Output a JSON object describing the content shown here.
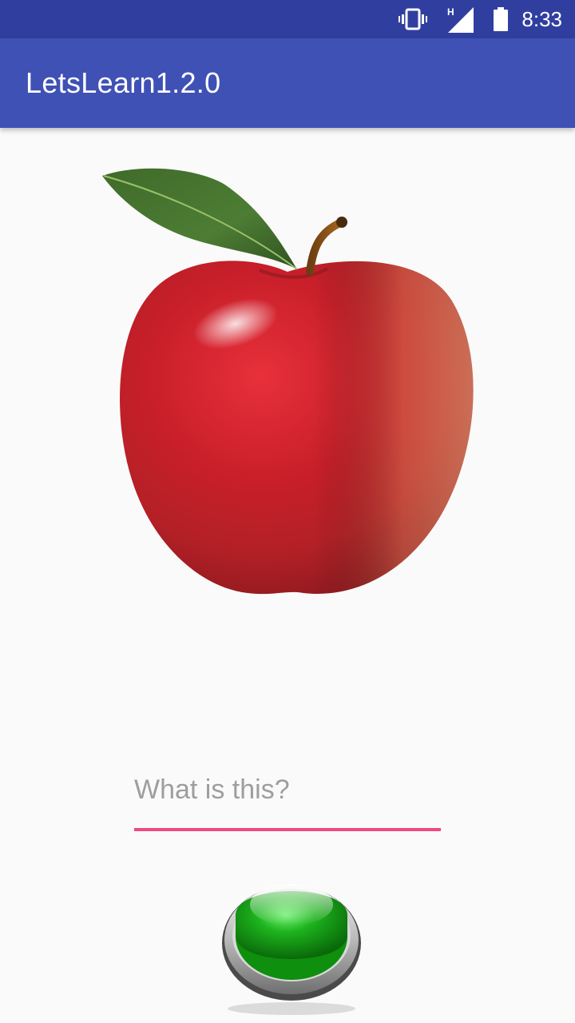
{
  "status_bar": {
    "time": "8:33",
    "network": "H",
    "icons": [
      "vibrate-icon",
      "signal-icon",
      "battery-icon"
    ]
  },
  "app_bar": {
    "title": "LetsLearn1.2.0"
  },
  "quiz": {
    "image_subject": "apple",
    "answer": {
      "value": "",
      "placeholder": "What is this?"
    },
    "submit_icon": "green-push-button-icon"
  },
  "colors": {
    "status_bar": "#303f9f",
    "app_bar": "#3f51b5",
    "accent": "#f04a7f",
    "background": "#fafafa"
  }
}
